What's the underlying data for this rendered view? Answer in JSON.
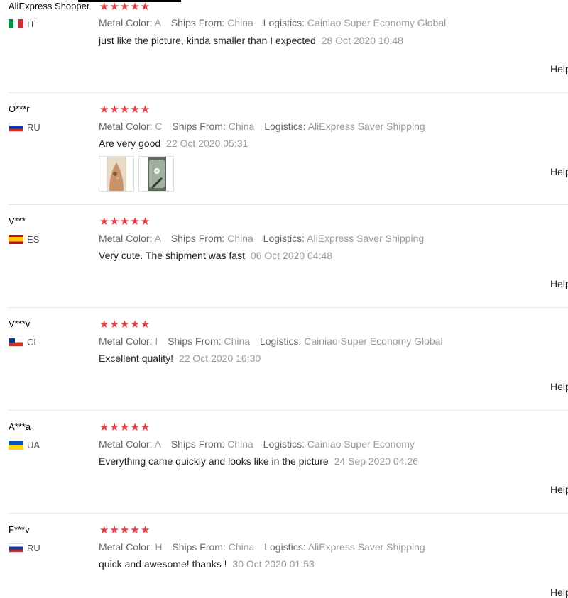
{
  "reviews": [
    {
      "user": "AliExpress Shopper",
      "country": "IT",
      "stars": "★★★★★",
      "metal_label": "Metal Color:",
      "metal_value": "A",
      "ships_label": "Ships From:",
      "ships_value": "China",
      "logistics_label": "Logistics:",
      "logistics_value": "Cainiao Super Economy Global",
      "text": "just like the picture, kinda smaller than I expected",
      "date": "28 Oct 2020 10:48",
      "helpful": "Helpful"
    },
    {
      "user": "O***r",
      "country": "RU",
      "stars": "★★★★★",
      "metal_label": "Metal Color:",
      "metal_value": "C",
      "ships_label": "Ships From:",
      "ships_value": "China",
      "logistics_label": "Logistics:",
      "logistics_value": "AliExpress Saver Shipping",
      "text": "Are very good",
      "date": "22 Oct 2020 05:31",
      "helpful": "Helpful"
    },
    {
      "user": "V***",
      "country": "ES",
      "stars": "★★★★★",
      "metal_label": "Metal Color:",
      "metal_value": "A",
      "ships_label": "Ships From:",
      "ships_value": "China",
      "logistics_label": "Logistics:",
      "logistics_value": "AliExpress Saver Shipping",
      "text": "Very cute. The shipment was fast",
      "date": "06 Oct 2020 04:48",
      "helpful": "Helpful"
    },
    {
      "user": "V***v",
      "country": "CL",
      "stars": "★★★★★",
      "metal_label": "Metal Color:",
      "metal_value": "I",
      "ships_label": "Ships From:",
      "ships_value": "China",
      "logistics_label": "Logistics:",
      "logistics_value": "Cainiao Super Economy Global",
      "text": "Excellent quality!",
      "date": "22 Oct 2020 16:30",
      "helpful": "Helpful"
    },
    {
      "user": "A***a",
      "country": "UA",
      "stars": "★★★★★",
      "metal_label": "Metal Color:",
      "metal_value": "A",
      "ships_label": "Ships From:",
      "ships_value": "China",
      "logistics_label": "Logistics:",
      "logistics_value": "Cainiao Super Economy",
      "text": "Everything came quickly and looks like in the picture",
      "date": "24 Sep 2020 04:26",
      "helpful": "Helpful"
    },
    {
      "user": "F***v",
      "country": "RU",
      "stars": "★★★★★",
      "metal_label": "Metal Color:",
      "metal_value": "H",
      "ships_label": "Ships From:",
      "ships_value": "China",
      "logistics_label": "Logistics:",
      "logistics_value": "AliExpress Saver Shipping",
      "text": "quick and awesome! thanks !",
      "date": "30 Oct 2020 01:53",
      "helpful": "Helpful"
    }
  ],
  "colors": {
    "star": "#f0383e",
    "divider": "#e8e8e8",
    "muted": "#999999",
    "label": "#666666"
  }
}
